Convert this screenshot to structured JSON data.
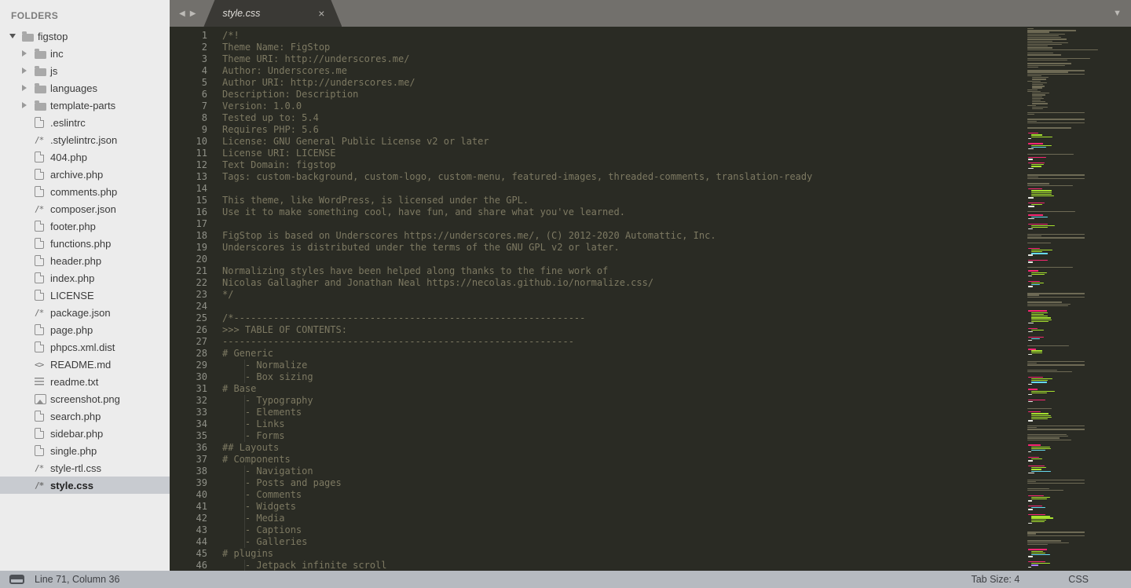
{
  "window": {
    "title": "style.css"
  },
  "sidebar": {
    "header": "FOLDERS",
    "icon_glyphs": {
      "css_json": "/*",
      "markdown": "<>"
    },
    "tree": [
      {
        "label": "figstop",
        "type": "folder-open",
        "depth": 0,
        "expanded": true
      },
      {
        "label": "inc",
        "type": "folder",
        "depth": 1
      },
      {
        "label": "js",
        "type": "folder",
        "depth": 1
      },
      {
        "label": "languages",
        "type": "folder",
        "depth": 1
      },
      {
        "label": "template-parts",
        "type": "folder",
        "depth": 1
      },
      {
        "label": ".eslintrc",
        "type": "file",
        "depth": 1
      },
      {
        "label": ".stylelintrc.json",
        "type": "file-json",
        "depth": 1
      },
      {
        "label": "404.php",
        "type": "file",
        "depth": 1
      },
      {
        "label": "archive.php",
        "type": "file",
        "depth": 1
      },
      {
        "label": "comments.php",
        "type": "file",
        "depth": 1
      },
      {
        "label": "composer.json",
        "type": "file-json",
        "depth": 1
      },
      {
        "label": "footer.php",
        "type": "file",
        "depth": 1
      },
      {
        "label": "functions.php",
        "type": "file",
        "depth": 1
      },
      {
        "label": "header.php",
        "type": "file",
        "depth": 1
      },
      {
        "label": "index.php",
        "type": "file",
        "depth": 1
      },
      {
        "label": "LICENSE",
        "type": "file",
        "depth": 1
      },
      {
        "label": "package.json",
        "type": "file-json",
        "depth": 1
      },
      {
        "label": "page.php",
        "type": "file",
        "depth": 1
      },
      {
        "label": "phpcs.xml.dist",
        "type": "file",
        "depth": 1
      },
      {
        "label": "README.md",
        "type": "file-markdown",
        "depth": 1
      },
      {
        "label": "readme.txt",
        "type": "file-text",
        "depth": 1
      },
      {
        "label": "screenshot.png",
        "type": "file-image",
        "depth": 1
      },
      {
        "label": "search.php",
        "type": "file",
        "depth": 1
      },
      {
        "label": "sidebar.php",
        "type": "file",
        "depth": 1
      },
      {
        "label": "single.php",
        "type": "file",
        "depth": 1
      },
      {
        "label": "style-rtl.css",
        "type": "file-css",
        "depth": 1
      },
      {
        "label": "style.css",
        "type": "file-css",
        "depth": 1,
        "selected": true
      }
    ]
  },
  "tabbar": {
    "scroll_left_icon": "◀",
    "scroll_right_icon": "▶",
    "overflow_icon": "▼",
    "tabs": [
      {
        "label": "style.css",
        "close_icon": "×",
        "active": true
      }
    ]
  },
  "editor": {
    "lines": [
      "/*!",
      "Theme Name: FigStop",
      "Theme URI: http://underscores.me/",
      "Author: Underscores.me",
      "Author URI: http://underscores.me/",
      "Description: Description",
      "Version: 1.0.0",
      "Tested up to: 5.4",
      "Requires PHP: 5.6",
      "License: GNU General Public License v2 or later",
      "License URI: LICENSE",
      "Text Domain: figstop",
      "Tags: custom-background, custom-logo, custom-menu, featured-images, threaded-comments, translation-ready",
      "",
      "This theme, like WordPress, is licensed under the GPL.",
      "Use it to make something cool, have fun, and share what you've learned.",
      "",
      "FigStop is based on Underscores https://underscores.me/, (C) 2012-2020 Automattic, Inc.",
      "Underscores is distributed under the terms of the GNU GPL v2 or later.",
      "",
      "Normalizing styles have been helped along thanks to the fine work of",
      "Nicolas Gallagher and Jonathan Neal https://necolas.github.io/normalize.css/",
      "*/",
      "",
      "/*--------------------------------------------------------------",
      ">>> TABLE OF CONTENTS:",
      "--------------------------------------------------------------",
      "# Generic",
      "\t- Normalize",
      "\t- Box sizing",
      "# Base",
      "\t- Typography",
      "\t- Elements",
      "\t- Links",
      "\t- Forms",
      "## Layouts",
      "# Components",
      "\t- Navigation",
      "\t- Posts and pages",
      "\t- Comments",
      "\t- Widgets",
      "\t- Media",
      "\t- Captions",
      "\t- Galleries",
      "# plugins",
      "\t- Jetpack infinite scroll"
    ]
  },
  "minimap": {
    "pattern": "scccccccccccC.cc.Cc.ccs.rcrsiisiiiissiiiiiiisii.rs..rsr..c..pggw..pgyw..c.pw.pggw...rsr..cc.pggggw..pgw..c.pyw..pggw..rsr..c..pggyw..pw..c.pggw..pgyw...rsr..ccc..pggggggw..pgw..pyw..c.pggw...rsr..cc..pggyw..pggw..pw...c.pggggw..rsr..cccc..pggyw..pgw..pggyw...rsr..cc..pggw..pyw..pggggw....rsr..ccc..pggyw..pguw."
  },
  "statusbar": {
    "position": "Line 71, Column 36",
    "tab_size": "Tab Size: 4",
    "syntax": "CSS"
  },
  "colors": {
    "editor_bg": "#2a2b24",
    "comment": "#7d7962",
    "gutter_fg": "#8f9087",
    "sidebar_bg": "#ececec",
    "sidebar_text": "#3b3b3b",
    "selected_bg": "#c8cbd0",
    "tabbar_bg": "#72706c",
    "tab_bg": "#3a3935",
    "tab_text": "#dedcd8",
    "status_bg": "#b6bac0",
    "status_text": "#3e4044",
    "minimap_olive": "#6e6a55",
    "minimap_pink": "#f92672",
    "minimap_green": "#a6e22e",
    "minimap_cyan": "#66d9ef",
    "minimap_white": "#e8e8e2",
    "minimap_purple": "#ae81ff"
  }
}
